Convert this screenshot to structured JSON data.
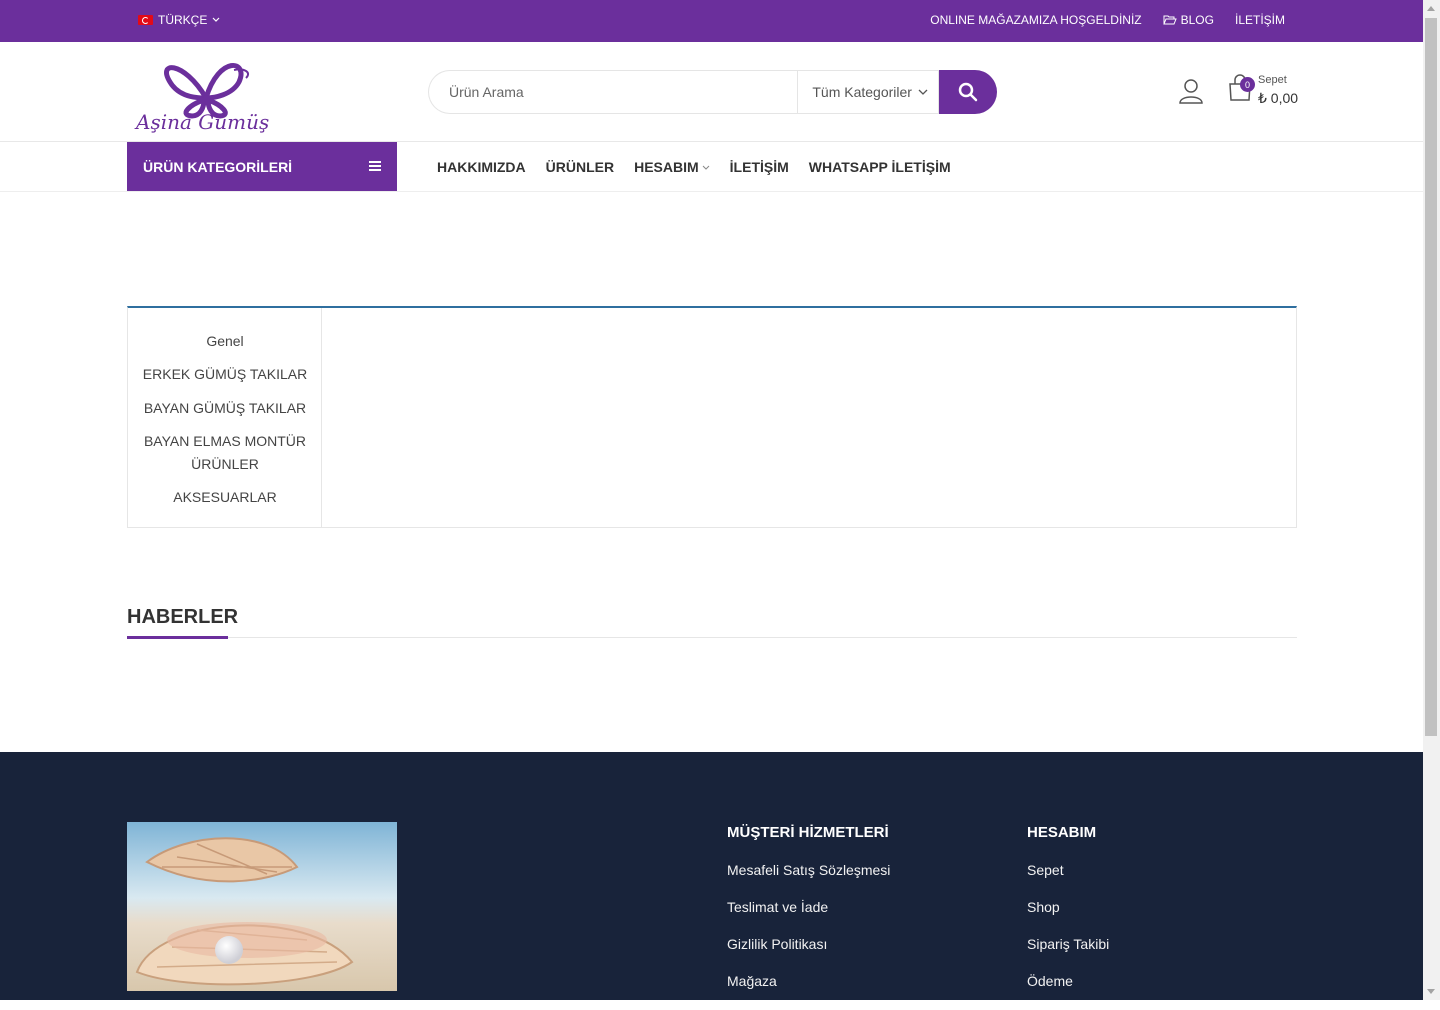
{
  "topbar": {
    "language": "TÜRKÇE",
    "welcome": "ONLINE MAĞAZAMIZA HOŞGELDİNİZ",
    "blog": "BLOG",
    "contact": "İLETİŞİM"
  },
  "header": {
    "logo_text": "Aşina Gümüş",
    "search_placeholder": "Ürün Arama",
    "category_select": "Tüm Kategoriler",
    "cart_label": "Sepet",
    "cart_count": "0",
    "cart_total": "₺ 0,00"
  },
  "nav": {
    "categories_button": "ÜRÜN KATEGORİLERİ",
    "items": [
      "HAKKIMIZDA",
      "ÜRÜNLER",
      "HESABIM",
      "İLETİŞİM",
      "WHATSAPP İLETİŞİM"
    ]
  },
  "categories": [
    "Genel",
    "ERKEK GÜMÜŞ TAKILAR",
    "BAYAN GÜMÜŞ TAKILAR",
    "BAYAN ELMAS MONTÜR ÜRÜNLER",
    "AKSESUARLAR"
  ],
  "news": {
    "title": "HABERLER"
  },
  "footer": {
    "customer_service": {
      "title": "MÜŞTERİ HİZMETLERİ",
      "links": [
        "Mesafeli Satış Sözleşmesi",
        "Teslimat ve İade",
        "Gizlilik Politikası",
        "Mağaza"
      ]
    },
    "account": {
      "title": "HESABIM",
      "links": [
        "Sepet",
        "Shop",
        "Sipariş Takibi",
        "Ödeme"
      ]
    }
  },
  "colors": {
    "brand": "#6b2f9c",
    "footer_bg": "#18233a",
    "box_top": "#2f6f9f"
  }
}
